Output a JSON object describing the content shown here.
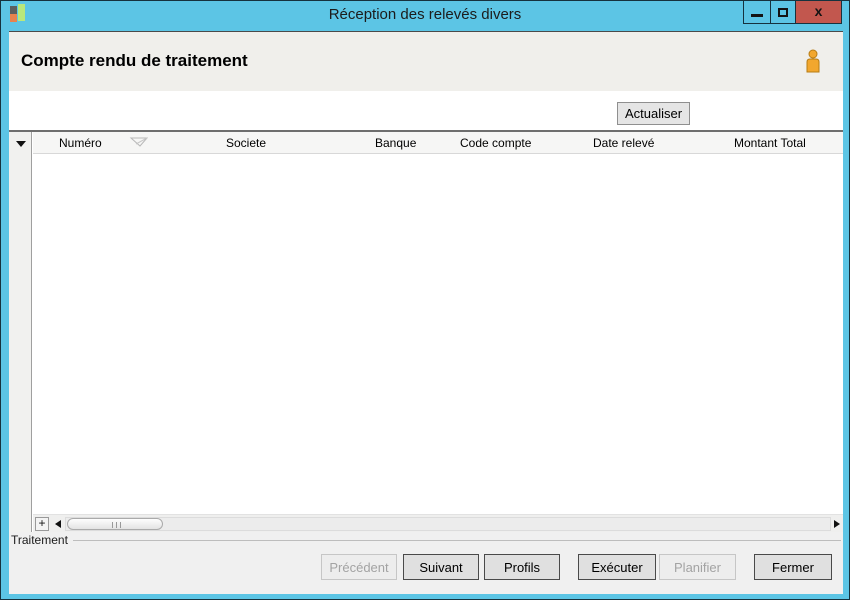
{
  "window": {
    "title": "Réception des relevés divers",
    "close_glyph": "x"
  },
  "colors": {
    "titlebar": "#5cc5e5",
    "close_button": "#c2574e",
    "frame_border": "#16323e",
    "user_icon": "#f2a72e"
  },
  "header": {
    "title": "Compte rendu de traitement"
  },
  "toolbar": {
    "refresh_label": "Actualiser"
  },
  "grid": {
    "columns": [
      "Numéro",
      "Societe",
      "Banque",
      "Code compte",
      "Date relevé",
      "Montant Total"
    ],
    "sorted_column": "Numéro",
    "rows": [],
    "add_row_label": "+"
  },
  "footer": {
    "group_label": "Traitement",
    "buttons": [
      {
        "label": "Précédent",
        "enabled": false
      },
      {
        "label": "Suivant",
        "enabled": true
      },
      {
        "label": "Profils",
        "enabled": true
      },
      {
        "label": "Exécuter",
        "enabled": true
      },
      {
        "label": "Planifier",
        "enabled": false
      },
      {
        "label": "Fermer",
        "enabled": true
      }
    ]
  }
}
